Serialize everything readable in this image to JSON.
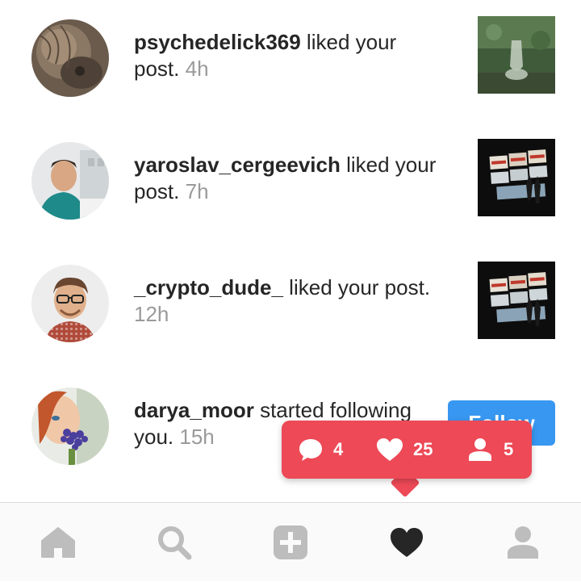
{
  "notifications": [
    {
      "username": "psychedelick369",
      "action": " liked your post.",
      "time": "4h"
    },
    {
      "username": "yaroslav_cergeevich",
      "action": " liked your post.",
      "time": "7h"
    },
    {
      "username": "_crypto_dude_",
      "action": " liked your post.",
      "time": "12h"
    },
    {
      "username": "darya_moor",
      "action": " started following you.",
      "time": "15h",
      "button_label": "Follow"
    }
  ],
  "activity_popup": {
    "comments": "4",
    "likes": "25",
    "followers": "5",
    "color": "#ed4956"
  },
  "tab_bar": {
    "items": [
      "home-icon",
      "search-icon",
      "add-post-icon",
      "activity-heart-icon",
      "profile-icon"
    ],
    "active": "activity-heart-icon"
  },
  "colors": {
    "follow_button": "#3897f0",
    "icon_inactive": "#bdbdbd",
    "icon_active": "#262626"
  }
}
